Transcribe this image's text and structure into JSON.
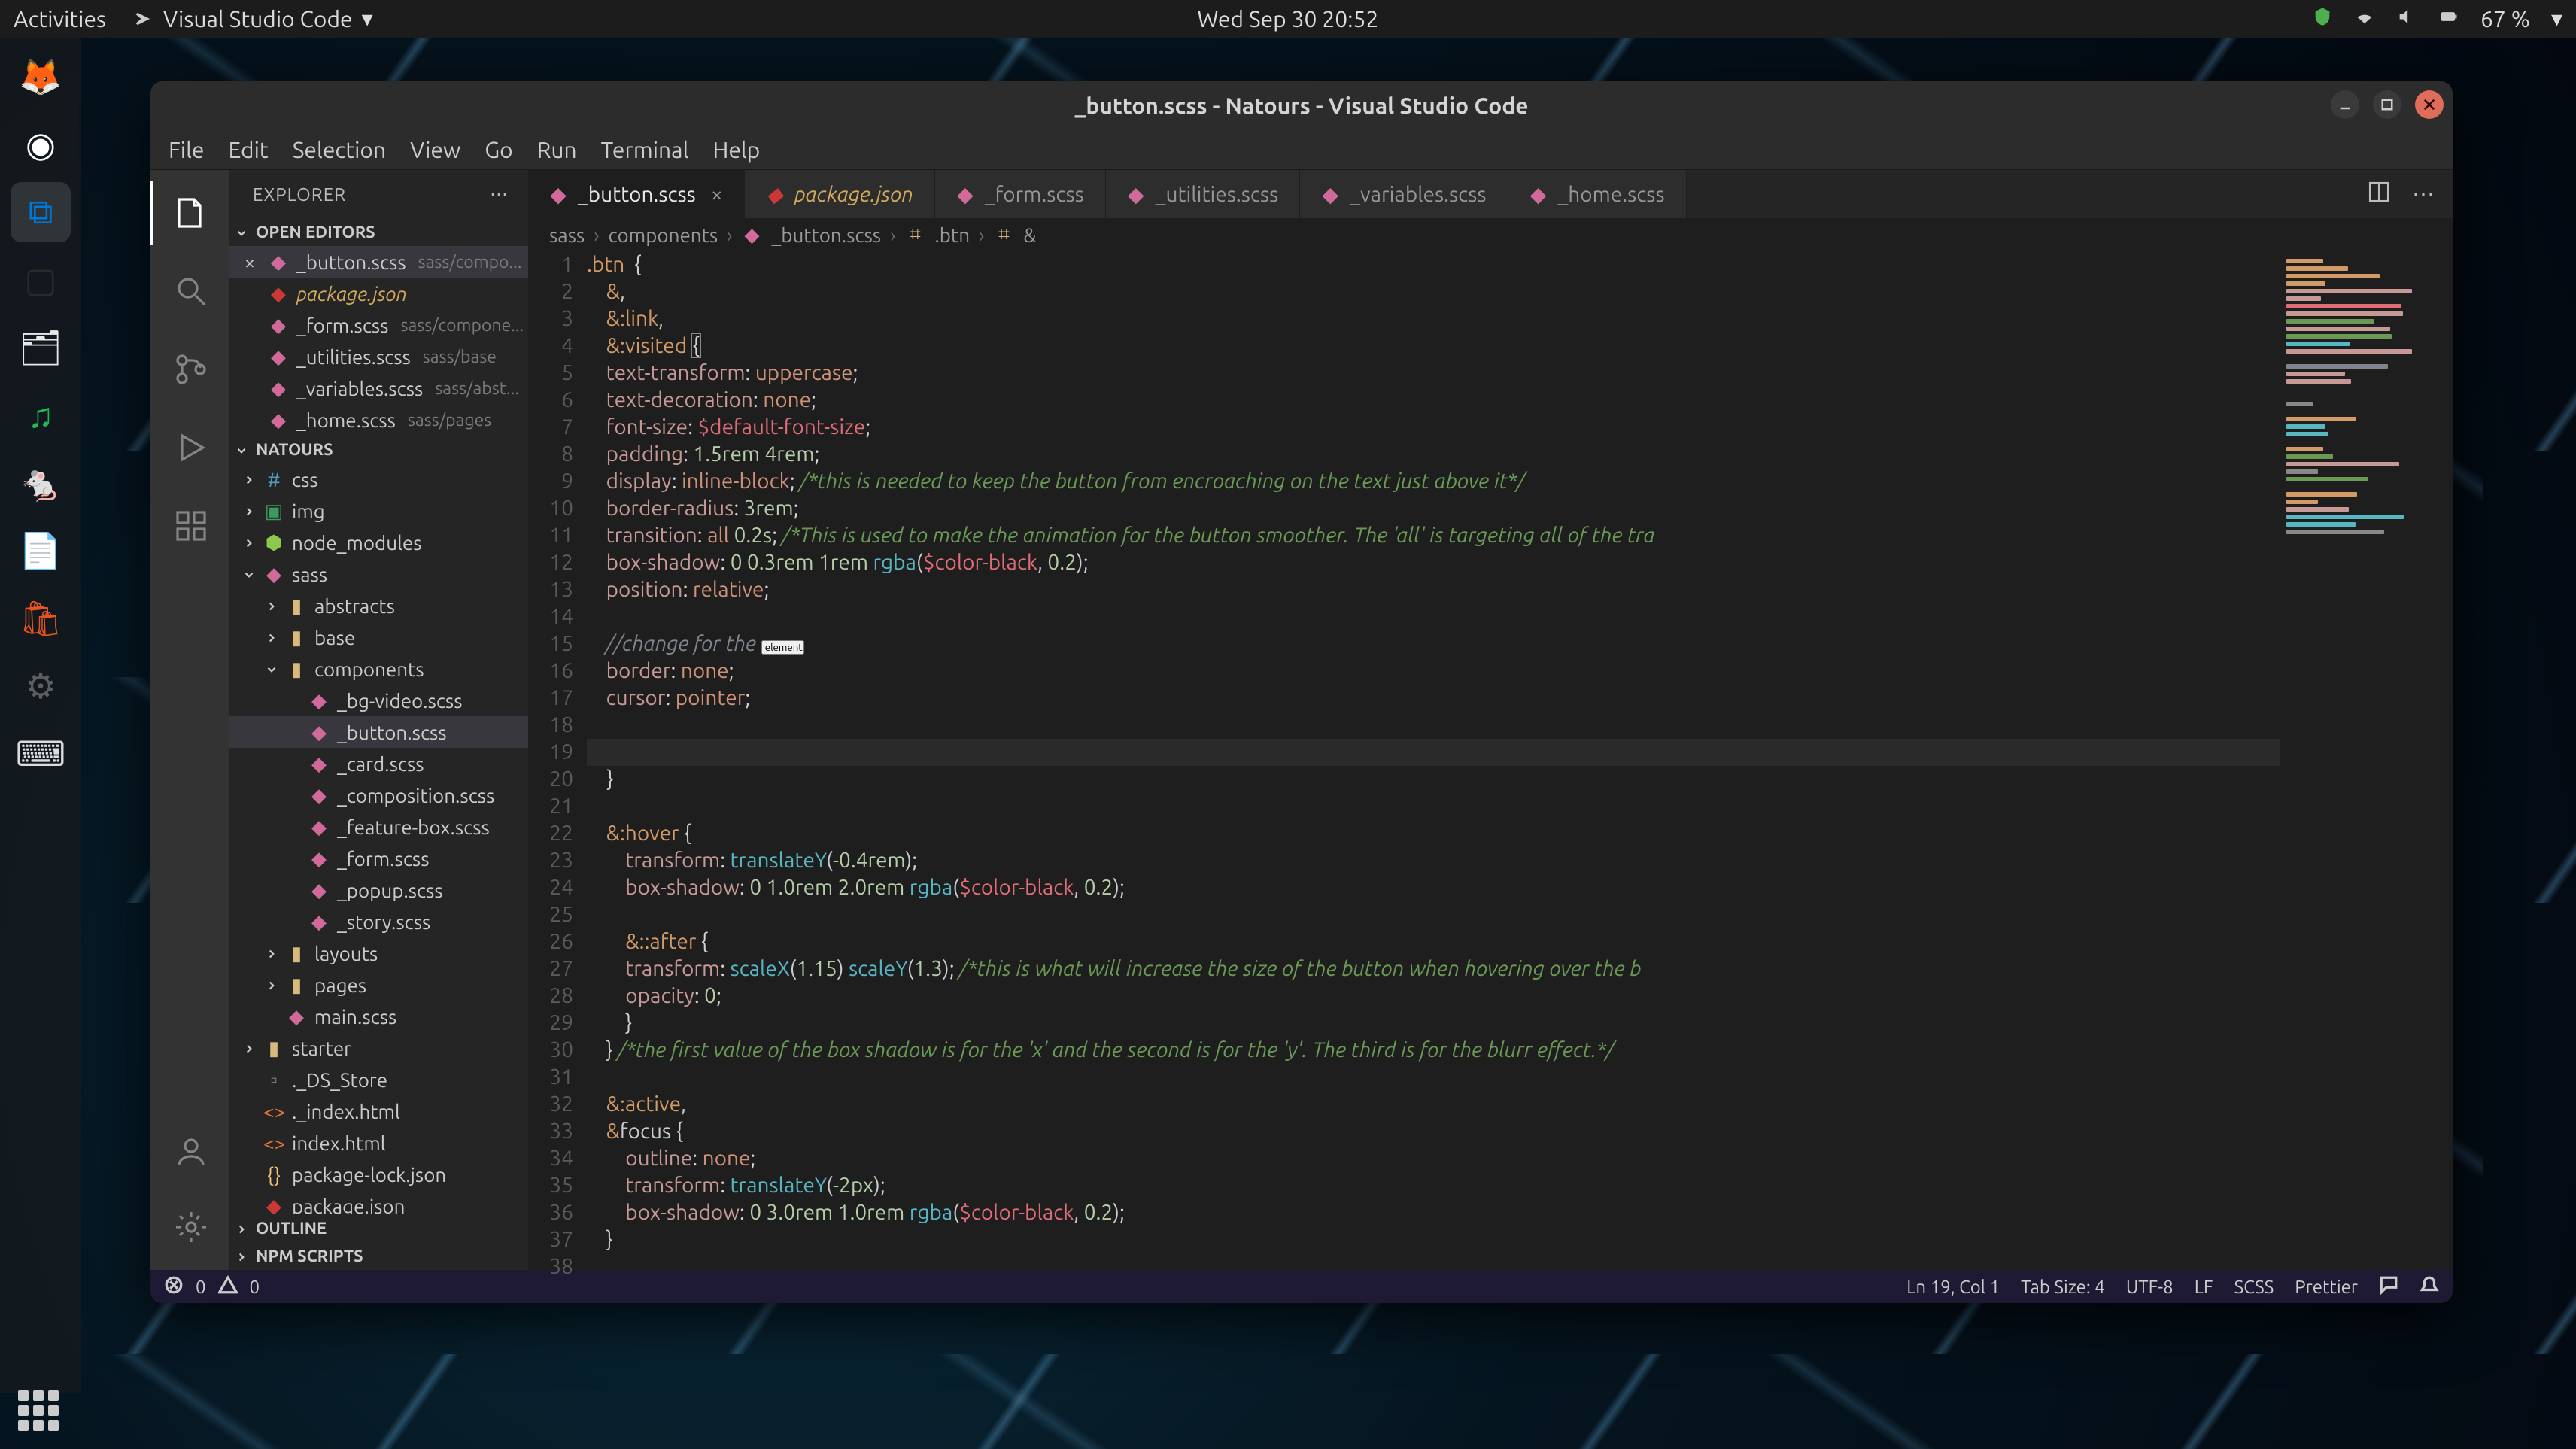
{
  "gnome": {
    "activities": "Activities",
    "app_name": "Visual Studio Code",
    "clock": "Wed Sep 30  20:52",
    "battery": "67 %"
  },
  "dock": [
    {
      "name": "firefox"
    },
    {
      "name": "chrome"
    },
    {
      "name": "vscode",
      "active": true
    },
    {
      "name": "terminal"
    },
    {
      "name": "files"
    },
    {
      "name": "spotify"
    },
    {
      "name": "robot"
    },
    {
      "name": "libreoffice"
    },
    {
      "name": "software"
    },
    {
      "name": "settings"
    },
    {
      "name": "toggle"
    }
  ],
  "window": {
    "title": "_button.scss - Natours - Visual Studio Code"
  },
  "menubar": [
    "File",
    "Edit",
    "Selection",
    "View",
    "Go",
    "Run",
    "Terminal",
    "Help"
  ],
  "sidebar": {
    "title": "EXPLORER",
    "open_editors_title": "OPEN EDITORS",
    "open_editors": [
      {
        "name": "_button.scss",
        "meta": "sass/compo...",
        "icon": "scss",
        "close": true,
        "active": true
      },
      {
        "name": "package.json",
        "meta": "",
        "icon": "pkg",
        "italic": true
      },
      {
        "name": "_form.scss",
        "meta": "sass/compone...",
        "icon": "scss"
      },
      {
        "name": "_utilities.scss",
        "meta": "sass/base",
        "icon": "scss"
      },
      {
        "name": "_variables.scss",
        "meta": "sass/abst...",
        "icon": "scss"
      },
      {
        "name": "_home.scss",
        "meta": "sass/pages",
        "icon": "scss"
      }
    ],
    "project_title": "NATOURS",
    "tree": [
      {
        "depth": 0,
        "chev": "right",
        "icon": "css",
        "label": "css",
        "kind": "folder"
      },
      {
        "depth": 0,
        "chev": "right",
        "icon": "img",
        "label": "img",
        "kind": "folder"
      },
      {
        "depth": 0,
        "chev": "right",
        "icon": "node",
        "label": "node_modules",
        "kind": "folder"
      },
      {
        "depth": 0,
        "chev": "down",
        "icon": "scss",
        "label": "sass",
        "kind": "folder"
      },
      {
        "depth": 1,
        "chev": "right",
        "icon": "folder",
        "label": "abstracts",
        "kind": "folder"
      },
      {
        "depth": 1,
        "chev": "right",
        "icon": "folder",
        "label": "base",
        "kind": "folder"
      },
      {
        "depth": 1,
        "chev": "down",
        "icon": "folder",
        "label": "components",
        "kind": "folder"
      },
      {
        "depth": 2,
        "icon": "scss",
        "label": "_bg-video.scss"
      },
      {
        "depth": 2,
        "icon": "scss",
        "label": "_button.scss",
        "active": true
      },
      {
        "depth": 2,
        "icon": "scss",
        "label": "_card.scss"
      },
      {
        "depth": 2,
        "icon": "scss",
        "label": "_composition.scss"
      },
      {
        "depth": 2,
        "icon": "scss",
        "label": "_feature-box.scss"
      },
      {
        "depth": 2,
        "icon": "scss",
        "label": "_form.scss"
      },
      {
        "depth": 2,
        "icon": "scss",
        "label": "_popup.scss"
      },
      {
        "depth": 2,
        "icon": "scss",
        "label": "_story.scss"
      },
      {
        "depth": 1,
        "chev": "right",
        "icon": "folder",
        "label": "layouts",
        "kind": "folder"
      },
      {
        "depth": 1,
        "chev": "right",
        "icon": "folder",
        "label": "pages",
        "kind": "folder"
      },
      {
        "depth": 1,
        "icon": "scss",
        "label": "main.scss"
      },
      {
        "depth": 0,
        "chev": "right",
        "icon": "folder",
        "label": "starter",
        "kind": "folder"
      },
      {
        "depth": 0,
        "icon": "generic",
        "label": "._DS_Store"
      },
      {
        "depth": 0,
        "icon": "html",
        "label": "._index.html"
      },
      {
        "depth": 0,
        "icon": "html",
        "label": "index.html"
      },
      {
        "depth": 0,
        "icon": "json",
        "label": "package-lock.json"
      },
      {
        "depth": 0,
        "icon": "pkg",
        "label": "package.json"
      }
    ],
    "outline_title": "OUTLINE",
    "npm_title": "NPM SCRIPTS"
  },
  "tabs": [
    {
      "label": "_button.scss",
      "icon": "scss",
      "active": true,
      "close": true
    },
    {
      "label": "package.json",
      "icon": "pkg",
      "dirty": true
    },
    {
      "label": "_form.scss",
      "icon": "scss"
    },
    {
      "label": "_utilities.scss",
      "icon": "scss"
    },
    {
      "label": "_variables.scss",
      "icon": "scss"
    },
    {
      "label": "_home.scss",
      "icon": "scss"
    }
  ],
  "breadcrumb": [
    "sass",
    "components",
    "_button.scss",
    ".btn",
    "&"
  ],
  "code_lines": [
    ".btn  {",
    "    &,",
    "    &:link,",
    "    &:visited {",
    "    text-transform: uppercase;",
    "    text-decoration: none;",
    "    font-size: $default-font-size;",
    "    padding: 1.5rem 4rem;",
    "    display: inline-block; /*this is needed to keep the button from encroaching on the text just above it*/",
    "    border-radius: 3rem;",
    "    transition: all 0.2s; /*This is used to make the animation for the button smoother. The 'all' is targeting all of the tra",
    "    box-shadow: 0 0.3rem 1rem rgba($color-black, 0.2);",
    "    position: relative;",
    "",
    "    //change for the <button> element",
    "    border: none;",
    "    cursor: pointer;",
    "",
    "    ",
    "    }",
    "",
    "    &:hover {",
    "        transform: translateY(-0.4rem);",
    "        box-shadow: 0 1.0rem 2.0rem rgba($color-black, 0.2);",
    "",
    "        &::after {",
    "        transform: scaleX(1.15) scaleY(1.3); /*this is what will increase the size of the button when hovering over the b",
    "        opacity: 0;",
    "        }",
    "    } /*the first value of the box shadow is for the 'x' and the second is for the 'y'. The third is for the blurr effect.*/",
    "",
    "    &:active,",
    "    &focus {",
    "        outline: none;",
    "        transform: translateY(-2px);",
    "        box-shadow: 0 3.0rem 1.0rem rgba($color-black, 0.2);",
    "    }",
    ""
  ],
  "status": {
    "errors": "0",
    "warnings": "0",
    "ln_col": "Ln 19, Col 1",
    "tab_size": "Tab Size: 4",
    "encoding": "UTF-8",
    "eol": "LF",
    "lang": "SCSS",
    "prettier": "Prettier"
  }
}
